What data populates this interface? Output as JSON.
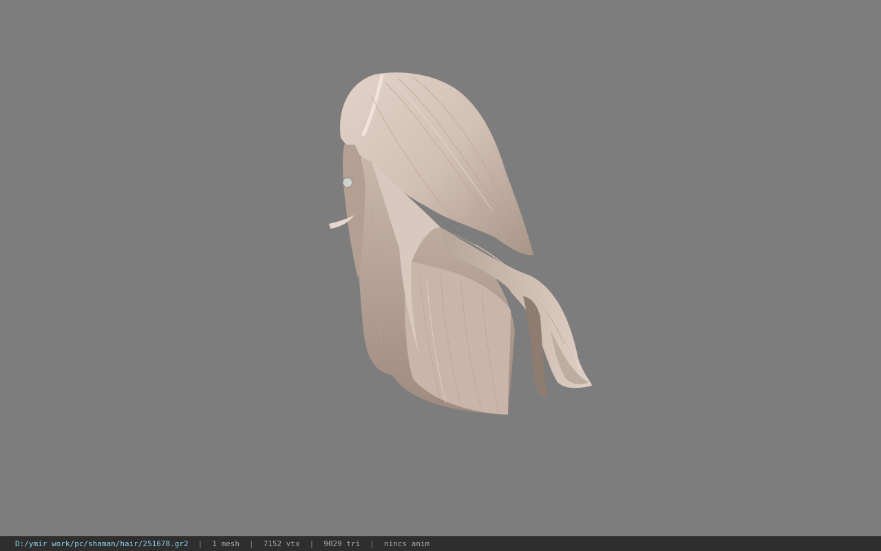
{
  "statusbar": {
    "file_path": "D:/ymir work/pc/shaman/hair/251678.gr2",
    "separator": "|",
    "mesh_count": "1 mesh",
    "vertex_count": "7152 vtx",
    "triangle_count": "9029 tri",
    "anim_status": "nincs anim"
  },
  "viewport": {
    "background_color": "#7d7d7d",
    "model_color": "#d8c6ba"
  }
}
